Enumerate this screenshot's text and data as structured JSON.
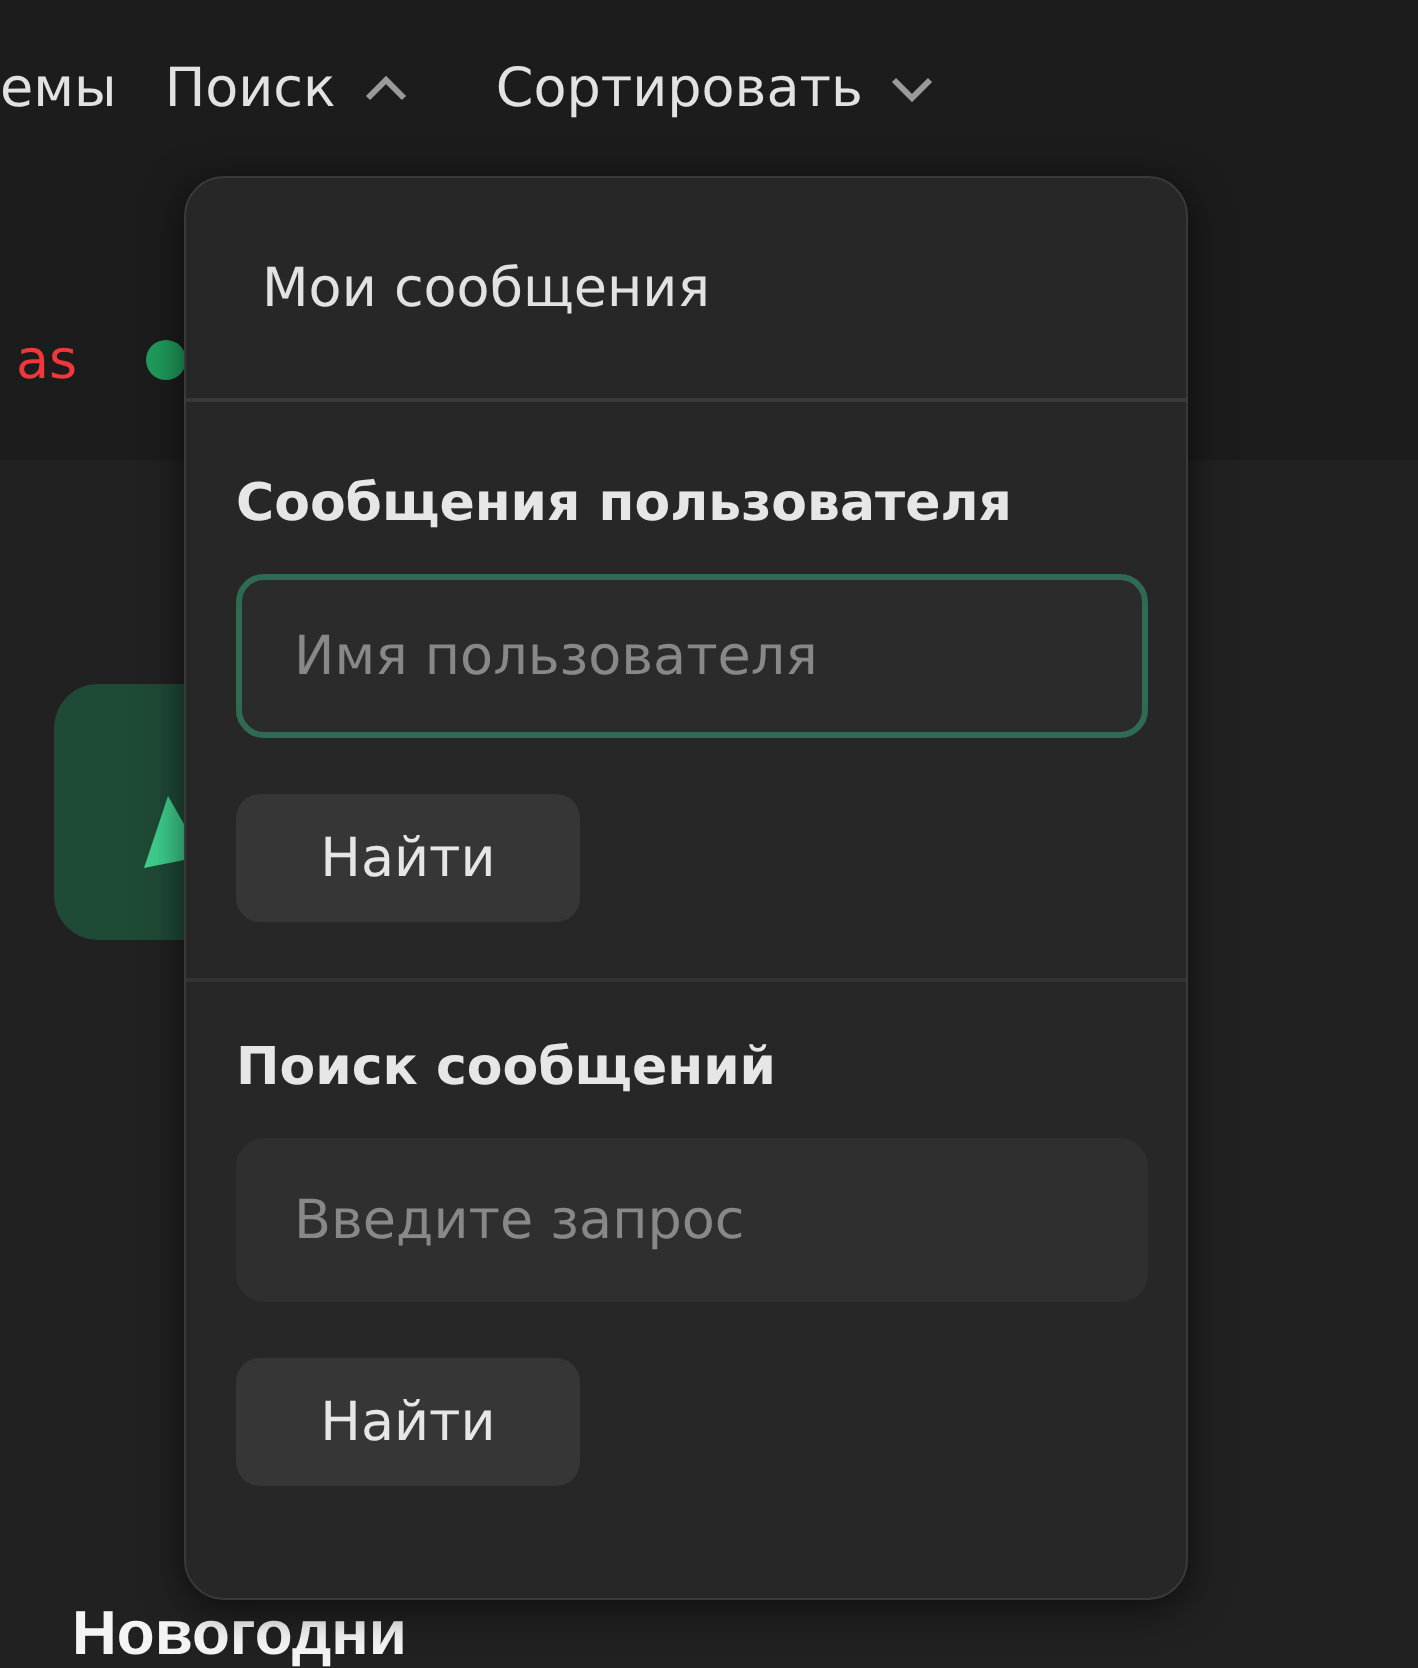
{
  "nav": [
    {
      "label": "емы",
      "kind": "link"
    },
    {
      "label": "Поиск",
      "kind": "dropdown",
      "expanded": true
    },
    {
      "label": "Сортировать",
      "kind": "dropdown",
      "expanded": false
    }
  ],
  "author": {
    "name": "as",
    "online": true
  },
  "heading": "Новогодни",
  "search_menu": {
    "my_messages": "Мои сообщения",
    "sections": [
      {
        "title": "Сообщения пользователя",
        "placeholder": "Имя пользователя",
        "focused": true,
        "button": "Найти"
      },
      {
        "title": "Поиск сообщений",
        "placeholder": "Введите запрос",
        "focused": false,
        "button": "Найти"
      }
    ]
  }
}
